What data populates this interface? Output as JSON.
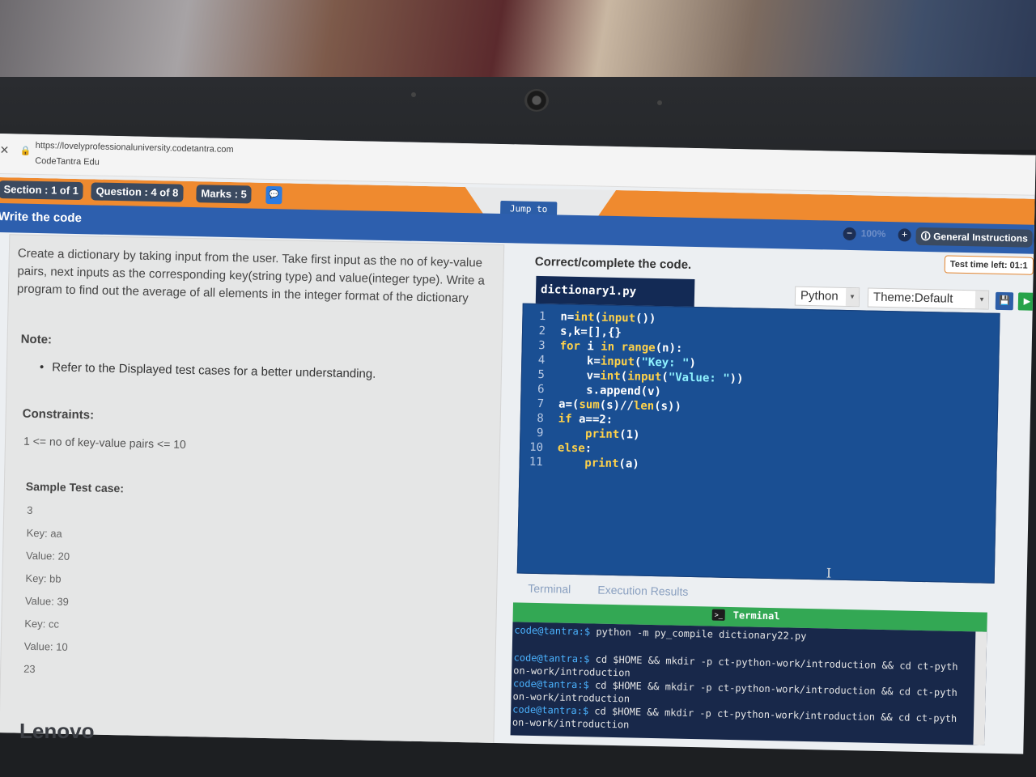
{
  "browser": {
    "url": "https://lovelyprofessionaluniversity.codetantra.com",
    "site_name": "CodeTantra Edu"
  },
  "header": {
    "section": "Section : 1 of 1",
    "question": "Question : 4 of 8",
    "marks": "Marks : 5",
    "jump_label": "Jump to",
    "page_title": "Write the code",
    "zoom_level": "100%",
    "instructions_label": "General Instructions",
    "timer": "Test time left: 01:1"
  },
  "question": {
    "problem": "Create a dictionary by taking input from the user. Take first input as the no of key-value pairs, next inputs as the corresponding key(string type) and value(integer type). Write a program to find out the average of all elements in the integer format of the dictionary",
    "note_heading": "Note:",
    "note_items": [
      "Refer to the Displayed test cases for a better understanding."
    ],
    "constraints_heading": "Constraints:",
    "constraints_text": "1 <= no of key-value pairs <= 10",
    "sample_heading": "Sample Test case:",
    "sample_lines": [
      "3",
      "Key: aa",
      "Value: 20",
      "Key: bb",
      "Value: 39",
      "Key: cc",
      "Value: 10",
      "23"
    ]
  },
  "editor": {
    "title": "Correct/complete the code.",
    "filename": "dictionary1.py",
    "language": "Python",
    "theme": "Theme:Default",
    "lines": [
      "n=int(input())",
      "s,k=[],{}",
      "for i in range(n):",
      "    k=input(\"Key: \")",
      "    v=int(input(\"Value: \"))",
      "    s.append(v)",
      "a=(sum(s)//len(s))",
      "if a==2:",
      "    print(1)",
      "else:",
      "    print(a)"
    ]
  },
  "bottom_tabs": [
    "Terminal",
    "Execution Results"
  ],
  "terminal": {
    "title": "Terminal",
    "lines": [
      {
        "prompt": "code@tantra:$",
        "cmd": " python  -m py_compile dictionary22.py"
      },
      {
        "prompt": "",
        "cmd": ""
      },
      {
        "prompt": "code@tantra:$",
        "cmd": " cd $HOME && mkdir -p ct-python-work/introduction && cd ct-pyth"
      },
      {
        "prompt": "",
        "cmd": "on-work/introduction"
      },
      {
        "prompt": "code@tantra:$",
        "cmd": " cd $HOME && mkdir -p ct-python-work/introduction && cd ct-pyth"
      },
      {
        "prompt": "",
        "cmd": "on-work/introduction"
      },
      {
        "prompt": "code@tantra:$",
        "cmd": " cd $HOME && mkdir -p ct-python-work/introduction && cd ct-pyth"
      },
      {
        "prompt": "",
        "cmd": "on-work/introduction"
      }
    ]
  },
  "device": {
    "brand": "Lenovo"
  }
}
